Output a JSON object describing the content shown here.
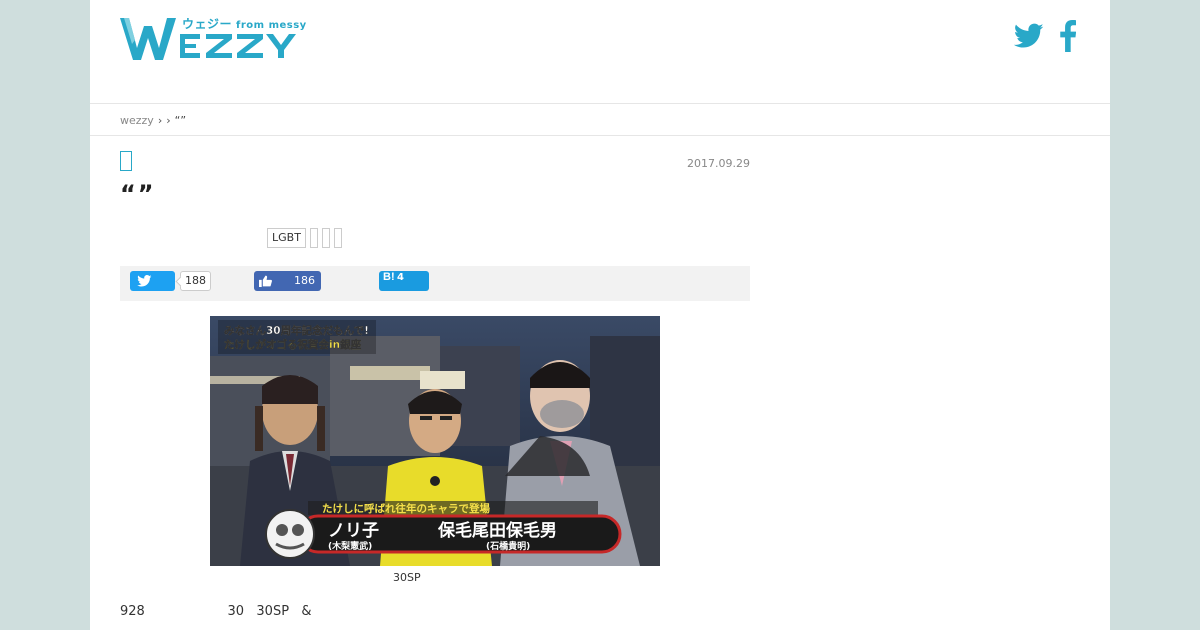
{
  "header": {
    "logo_text": "WEZZY",
    "logo_kana": "ウェジー",
    "logo_from": "from messy",
    "social": [
      "twitter-icon",
      "facebook-icon"
    ]
  },
  "breadcrumb": {
    "home": "wezzy",
    "sep1": "›",
    "sep2": "›",
    "current": "“”"
  },
  "article": {
    "date": "2017.09.29",
    "title": "“”",
    "tags": [
      "LGBT"
    ],
    "share": {
      "twitter_count": "188",
      "facebook_count": "186",
      "hatena_count": "4",
      "hatena_logo": "B!"
    },
    "photo": {
      "banner_line1": "みなさん30周年記念だもんで!",
      "banner_line2": "たけしがオゴる祝賀会in銀座",
      "subtitle_top": "たけしに呼ばれ往年のキャラで登場",
      "name_left": "ノリ子",
      "name_left_sub": "(木梨憲武)",
      "name_right": "保毛尾田保毛男",
      "name_right_sub": "(石橋貴明)"
    },
    "caption": "30SP",
    "body_line": "928                    30   30SP   &"
  },
  "colors": {
    "accent": "#29a8c8",
    "background": "#cfdedd",
    "twitter": "#1da1f2",
    "facebook": "#4267b2",
    "hatena": "#1a9be0"
  }
}
